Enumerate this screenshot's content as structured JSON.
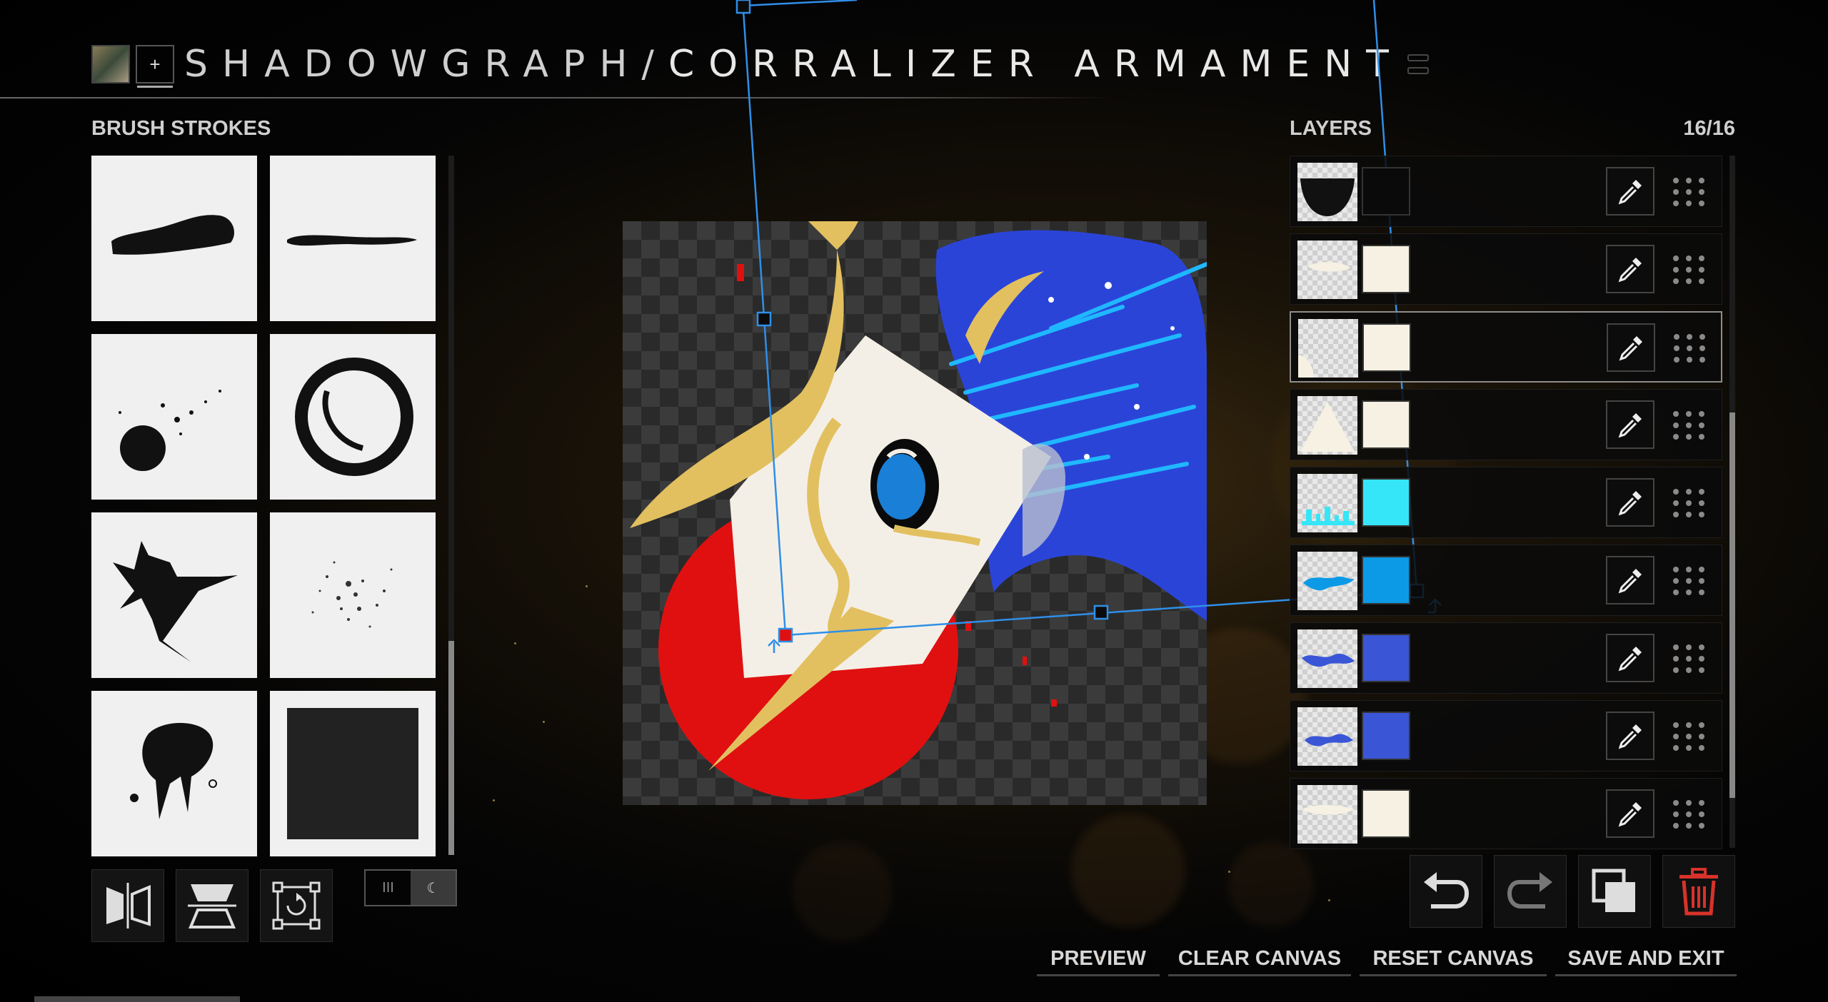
{
  "header": {
    "title_prefix": "SHADOWGRAPH/",
    "title_main": "CORRALIZER ARMAMENT",
    "add_label": "+"
  },
  "brush_panel": {
    "label": "BRUSH STROKES",
    "brushes": [
      {
        "name": "brush-smear"
      },
      {
        "name": "brush-line"
      },
      {
        "name": "brush-splatter-dot"
      },
      {
        "name": "brush-ring"
      },
      {
        "name": "brush-ink-splash"
      },
      {
        "name": "brush-speckle"
      },
      {
        "name": "brush-drip"
      },
      {
        "name": "brush-square"
      }
    ],
    "tools": [
      "mirror-horizontal-icon",
      "mirror-vertical-icon",
      "transform-icon"
    ],
    "toggle": {
      "left": "III",
      "right": "☾"
    }
  },
  "layers_panel": {
    "label": "LAYERS",
    "count": "16/16",
    "layers": [
      {
        "color": "#0a0a0a",
        "thumb": "half-circle-black",
        "selected": false
      },
      {
        "color": "#f6f1e2",
        "thumb": "cream-smudge",
        "selected": false
      },
      {
        "color": "#f6f1e2",
        "thumb": "cream-corner",
        "selected": true
      },
      {
        "color": "#f6f1e2",
        "thumb": "cream-triangle",
        "selected": false
      },
      {
        "color": "#35e6f8",
        "thumb": "cyan-splash",
        "selected": false
      },
      {
        "color": "#0c9ae6",
        "thumb": "blue-streak",
        "selected": false
      },
      {
        "color": "#3a56d6",
        "thumb": "blue-wave",
        "selected": false
      },
      {
        "color": "#3a56d6",
        "thumb": "blue-wave-2",
        "selected": false
      },
      {
        "color": "#f6f1e2",
        "thumb": "cream-smear",
        "selected": false
      }
    ],
    "actions": [
      "undo-icon",
      "redo-icon",
      "duplicate-icon",
      "delete-icon"
    ]
  },
  "bottom_buttons": {
    "preview": "PREVIEW",
    "clear": "CLEAR CANVAS",
    "reset": "RESET CANVAS",
    "save": "SAVE AND EXIT"
  },
  "colors": {
    "accent_selection": "#2f8fe8",
    "delete_red": "#d8322a",
    "canvas_red": "#e01010",
    "canvas_gold": "#e2c060",
    "canvas_blue": "#2b44d8",
    "canvas_cyan": "#1fb8ff"
  }
}
